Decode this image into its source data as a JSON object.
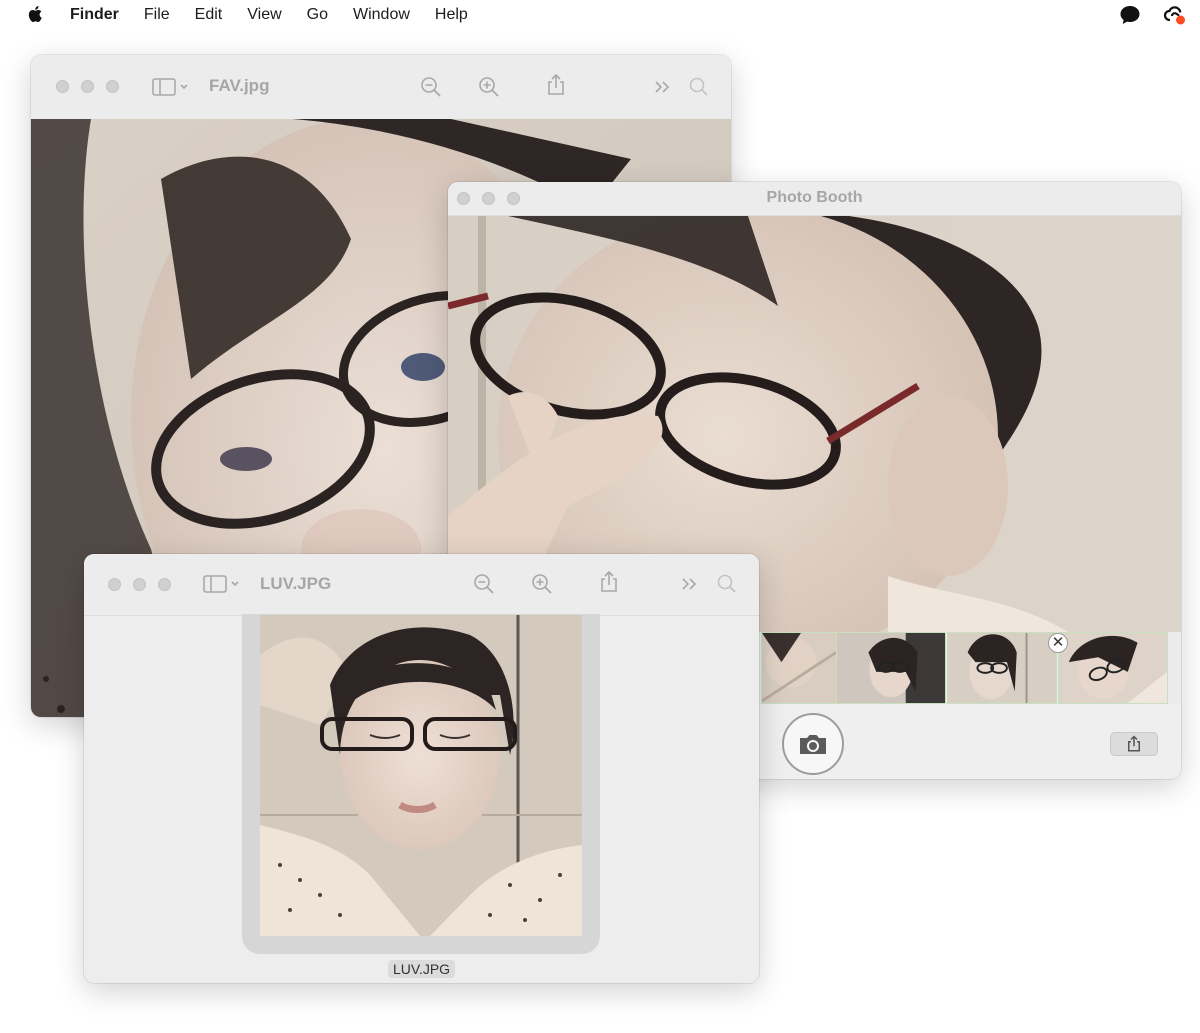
{
  "menubar": {
    "apple_icon": "apple-logo",
    "items": [
      "Finder",
      "File",
      "Edit",
      "View",
      "Go",
      "Window",
      "Help"
    ],
    "status_icons": [
      "messages-icon",
      "creative-cloud-icon"
    ]
  },
  "windows": {
    "fav": {
      "title": "FAV.jpg",
      "toolbar_icons": [
        "sidebar-icon",
        "zoom-out-icon",
        "zoom-in-icon",
        "share-icon",
        "more-icon",
        "search-icon"
      ]
    },
    "photobooth": {
      "title": "Photo Booth",
      "thumbnail_count": 4,
      "controls": [
        "camera-icon",
        "share-icon",
        "close-icon"
      ]
    },
    "luv": {
      "title": "LUV.JPG",
      "file_label": "LUV.JPG",
      "toolbar_icons": [
        "sidebar-icon",
        "zoom-out-icon",
        "zoom-in-icon",
        "share-icon",
        "more-icon",
        "search-icon"
      ]
    }
  },
  "colors": {
    "window_bg": "#f2f2f2",
    "title_text": "#a6a6a6",
    "traffic_dot": "#d0d0d0",
    "accent_notification": "#ff4b1f"
  }
}
